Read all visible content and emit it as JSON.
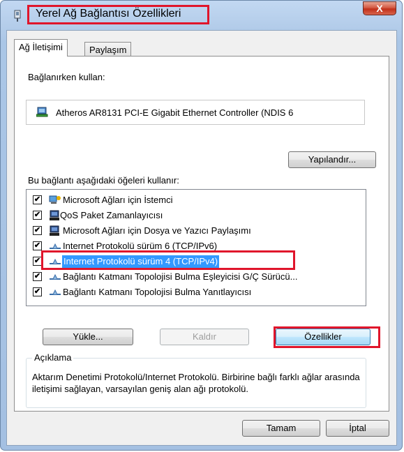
{
  "window": {
    "title": "Yerel Ağ Bağlantısı Özellikleri",
    "close_label": "X"
  },
  "tabs": [
    {
      "label": "Ağ İletişimi",
      "active": true
    },
    {
      "label": "Paylaşım",
      "active": false
    }
  ],
  "connect_using": {
    "label": "Bağlanırken kullan:",
    "adapter": "Atheros AR8131 PCI-E Gigabit Ethernet Controller (NDIS 6",
    "configure_button": "Yapılandır..."
  },
  "items_section": {
    "label": "Bu bağlantı aşağıdaki öğeleri kullanır:",
    "items": [
      {
        "label": "Microsoft Ağları için İstemci",
        "checked": true,
        "icon": "network-client-icon",
        "selected": false
      },
      {
        "label": "QoS Paket Zamanlayıcısı",
        "checked": true,
        "icon": "service-icon",
        "selected": false
      },
      {
        "label": "Microsoft Ağları için Dosya ve Yazıcı Paylaşımı",
        "checked": true,
        "icon": "service-icon",
        "selected": false
      },
      {
        "label": "Internet Protokolü sürüm 6 (TCP/IPv6)",
        "checked": true,
        "icon": "protocol-icon",
        "selected": false
      },
      {
        "label": "Internet Protokolü sürüm 4 (TCP/IPv4)",
        "checked": true,
        "icon": "protocol-icon",
        "selected": true
      },
      {
        "label": "Bağlantı Katmanı Topolojisi Bulma Eşleyicisi G/Ç Sürücü...",
        "checked": true,
        "icon": "protocol-icon",
        "selected": false
      },
      {
        "label": "Bağlantı Katmanı Topolojisi Bulma Yanıtlayıcısı",
        "checked": true,
        "icon": "protocol-icon",
        "selected": false
      }
    ]
  },
  "buttons": {
    "install": "Yükle...",
    "uninstall": "Kaldır",
    "properties": "Özellikler"
  },
  "description": {
    "title": "Açıklama",
    "text": "Aktarım Denetimi Protokolü/Internet Protokolü. Birbirine bağlı farklı ağlar arasında iletişimi sağlayan, varsayılan geniş alan ağı protokolü."
  },
  "footer": {
    "ok": "Tamam",
    "cancel": "İptal"
  },
  "colors": {
    "highlight_box": "#e0152b",
    "selection": "#3399ff"
  }
}
